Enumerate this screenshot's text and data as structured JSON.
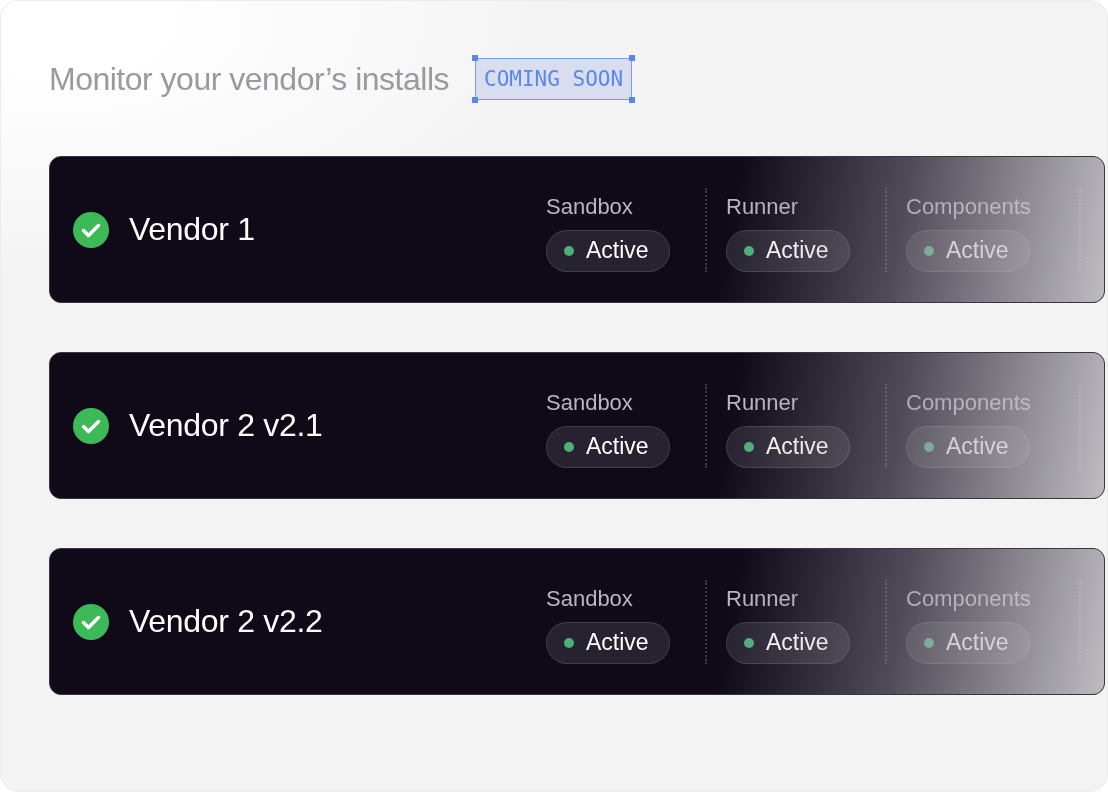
{
  "heading": "Monitor your vendor’s installs",
  "badge": "COMING SOON",
  "vendors": [
    {
      "name": "Vendor 1",
      "services": [
        {
          "label": "Sandbox",
          "status": "Active"
        },
        {
          "label": "Runner",
          "status": "Active"
        },
        {
          "label": "Components",
          "status": "Active"
        }
      ]
    },
    {
      "name": "Vendor 2 v2.1",
      "services": [
        {
          "label": "Sandbox",
          "status": "Active"
        },
        {
          "label": "Runner",
          "status": "Active"
        },
        {
          "label": "Components",
          "status": "Active"
        }
      ]
    },
    {
      "name": "Vendor 2 v2.2",
      "services": [
        {
          "label": "Sandbox",
          "status": "Active"
        },
        {
          "label": "Runner",
          "status": "Active"
        },
        {
          "label": "Components",
          "status": "Active"
        }
      ]
    }
  ]
}
